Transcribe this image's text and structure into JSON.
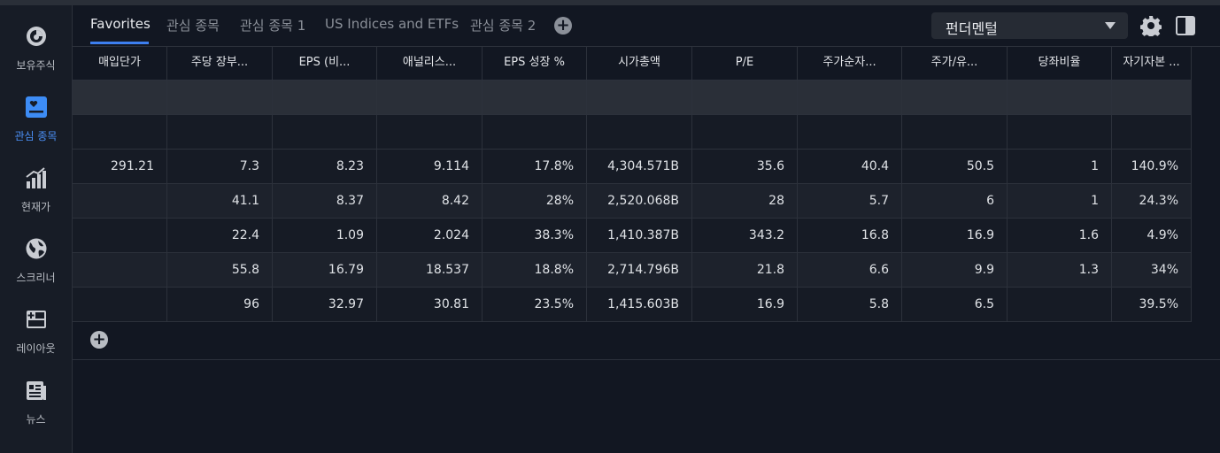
{
  "sidebar": {
    "items": [
      {
        "label": "보유주식",
        "icon": "portfolio-icon"
      },
      {
        "label": "관심 종목",
        "icon": "watchlist-icon",
        "active": true
      },
      {
        "label": "현재가",
        "icon": "quote-chart-icon"
      },
      {
        "label": "스크리너",
        "icon": "globe-icon"
      },
      {
        "label": "레이아웃",
        "icon": "layout-add-icon"
      },
      {
        "label": "뉴스",
        "icon": "news-icon"
      }
    ]
  },
  "tabs": [
    {
      "label": "Favorites",
      "active": true
    },
    {
      "label": "관심 종목"
    },
    {
      "label": "관심 종목 1"
    },
    {
      "label": "US Indices and ETFs"
    },
    {
      "label": "관심 종목 2"
    }
  ],
  "toolbar": {
    "view_select": "펀더멘털",
    "add_tab": "+"
  },
  "table": {
    "columns": [
      "매입단가",
      "주당 장부...",
      "EPS (비...",
      "애널리스...",
      "EPS 성장 %",
      "시가총액",
      "P/E",
      "주가순자...",
      "주가/유...",
      "당좌비율",
      "자기자본 ..."
    ],
    "rows": [
      [
        "",
        "",
        "",
        "",
        "",
        "",
        "",
        "",
        "",
        "",
        ""
      ],
      [
        "",
        "",
        "",
        "",
        "",
        "",
        "",
        "",
        "",
        "",
        ""
      ],
      [
        "291.21",
        "7.3",
        "8.23",
        "9.114",
        "17.8%",
        "4,304.571B",
        "35.6",
        "40.4",
        "50.5",
        "1",
        "140.9%"
      ],
      [
        "",
        "41.1",
        "8.37",
        "8.42",
        "28%",
        "2,520.068B",
        "28",
        "5.7",
        "6",
        "1",
        "24.3%"
      ],
      [
        "",
        "22.4",
        "1.09",
        "2.024",
        "38.3%",
        "1,410.387B",
        "343.2",
        "16.8",
        "16.9",
        "1.6",
        "4.9%"
      ],
      [
        "",
        "55.8",
        "16.79",
        "18.537",
        "18.8%",
        "2,714.796B",
        "21.8",
        "6.6",
        "9.9",
        "1.3",
        "34%"
      ],
      [
        "",
        "96",
        "32.97",
        "30.81",
        "23.5%",
        "1,415.603B",
        "16.9",
        "5.8",
        "6.5",
        "",
        "39.5%"
      ]
    ],
    "add_row": "+"
  },
  "colors": {
    "accent": "#3d7ff0",
    "background": "#121722",
    "sidebar": "#171c26"
  }
}
